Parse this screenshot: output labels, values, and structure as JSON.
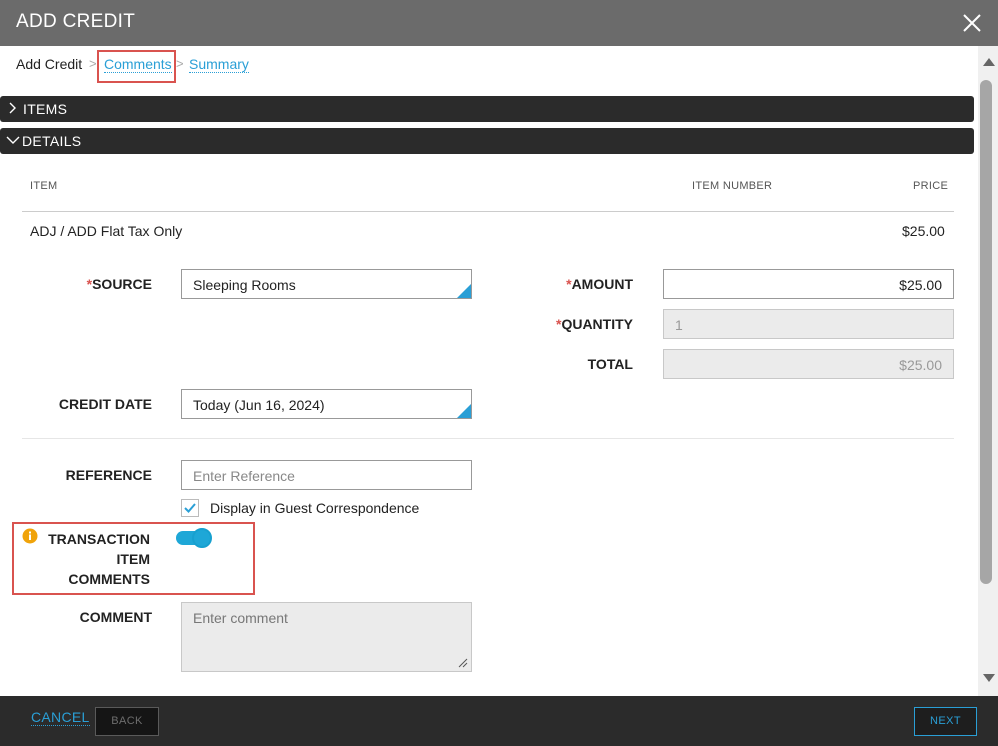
{
  "dialog": {
    "title": "ADD CREDIT"
  },
  "breadcrumb": {
    "items": [
      "Add Credit",
      "Comments",
      "Summary"
    ],
    "separator": ">"
  },
  "sections": {
    "items_label": "ITEMS",
    "details_label": "DETAILS"
  },
  "table": {
    "headers": {
      "item": "ITEM",
      "item_number": "ITEM NUMBER",
      "price": "PRICE"
    },
    "row": {
      "item": "ADJ / ADD Flat Tax Only",
      "item_number": "",
      "price": "$25.00"
    }
  },
  "form": {
    "required_mark": "*",
    "source": {
      "label": "SOURCE",
      "value": "Sleeping Rooms"
    },
    "amount": {
      "label": "AMOUNT",
      "value": "$25.00"
    },
    "quantity": {
      "label": "QUANTITY",
      "value": "1"
    },
    "total": {
      "label": "TOTAL",
      "value": "$25.00"
    },
    "credit_date": {
      "label": "CREDIT DATE",
      "value": "Today (Jun 16, 2024)"
    },
    "reference": {
      "label": "REFERENCE",
      "placeholder": "Enter Reference"
    },
    "display_checkbox": {
      "label": "Display in Guest Correspondence",
      "checked": true
    },
    "transaction_comments": {
      "label_lines": [
        "TRANSACTION",
        "ITEM",
        "COMMENTS"
      ],
      "enabled": true
    },
    "comment": {
      "label": "COMMENT",
      "placeholder": "Enter comment"
    }
  },
  "footer": {
    "cancel": "CANCEL",
    "back": "BACK",
    "next": "NEXT"
  },
  "colors": {
    "accent": "#2a9fd6",
    "toggle": "#1ea7d7",
    "required": "#d9534f",
    "highlight": "#d9534f",
    "info": "#f0a30a",
    "titlebar": "#6b6b6b",
    "bar": "#2b2b2b"
  },
  "icons": {
    "close": "close-icon",
    "info": "info-icon",
    "check": "check-icon",
    "chevron_right": "chevron-right-icon",
    "chevron_down": "chevron-down-icon"
  }
}
